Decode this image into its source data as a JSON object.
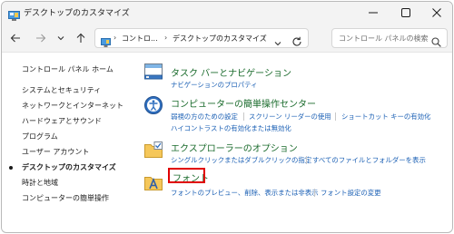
{
  "window": {
    "title": "デスクトップのカスタマイズ"
  },
  "address": {
    "crumbs": [
      "コントロ...",
      "デスクトップのカスタマイズ"
    ],
    "separator": "›"
  },
  "search": {
    "placeholder": "コントロール パネルの検索"
  },
  "sidebar": {
    "home": "コントロール パネル ホーム",
    "items": [
      "システムとセキュリティ",
      "ネットワークとインターネット",
      "ハードウェアとサウンド",
      "プログラム",
      "ユーザー アカウント",
      "デスクトップのカスタマイズ",
      "時計と地域",
      "コンピューターの簡単操作"
    ],
    "selected": "デスクトップのカスタマイズ"
  },
  "entries": [
    {
      "title": "タスク バーとナビゲーション",
      "icon": "taskbar-icon",
      "links": [
        "ナビゲーションのプロパティ"
      ]
    },
    {
      "title": "コンピューターの簡単操作センター",
      "icon": "ease-of-access-icon",
      "links": [
        "弱視の方のための設定",
        "スクリーン リーダーの使用",
        "ショートカット キーの有効化",
        "ハイコントラストの有効化または無効化"
      ]
    },
    {
      "title": "エクスプローラーのオプション",
      "icon": "folder-options-icon",
      "links": [
        "シングルクリックまたはダブルクリックの指定",
        "すべてのファイルとフォルダーを表示"
      ]
    },
    {
      "title": "フォント",
      "icon": "fonts-icon",
      "links": [
        "フォントのプレビュー、削除、表示または非表示",
        "フォント設定の変更"
      ]
    }
  ],
  "colors": {
    "title_green": "#1a6b2c",
    "link_blue": "#1a5fb4",
    "highlight_red": "#e00000"
  }
}
